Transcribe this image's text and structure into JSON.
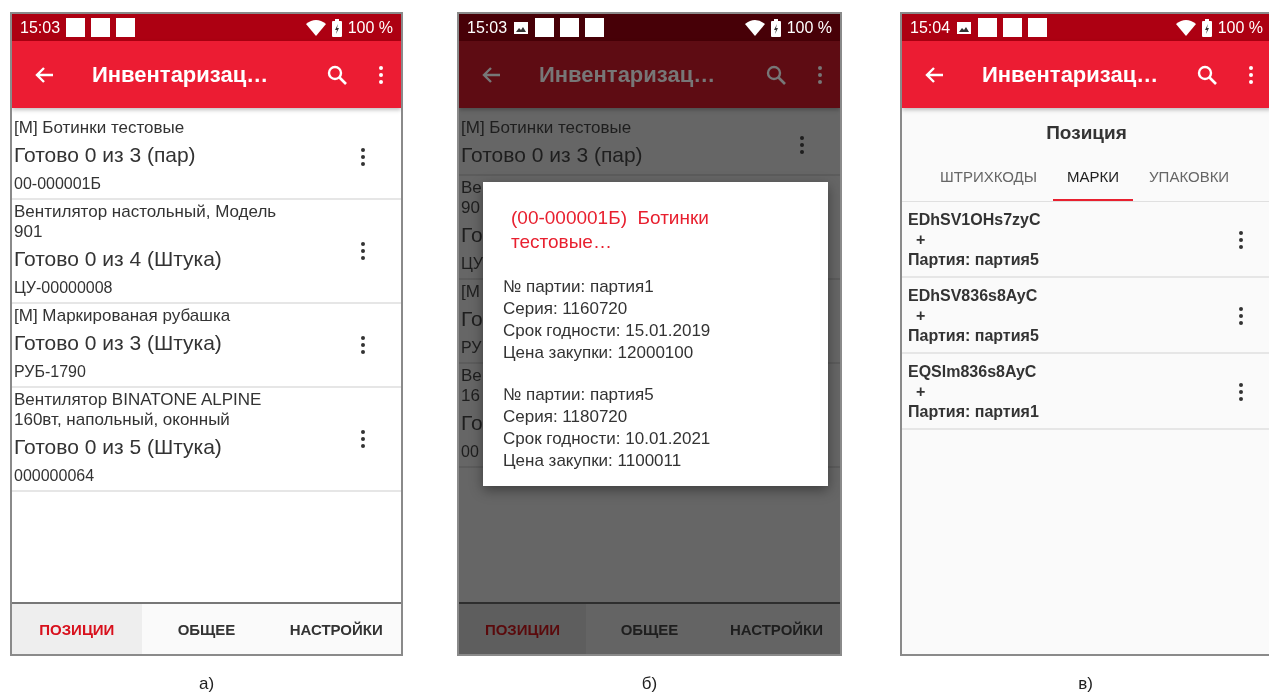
{
  "screens": [
    {
      "kind": "positions",
      "caption": "а)",
      "dimmed": false,
      "status_bar": {
        "time": "15:03",
        "notifications": [
          {
            "kind": "square"
          },
          {
            "kind": "square"
          },
          {
            "kind": "square"
          }
        ],
        "battery": "100 %"
      },
      "app_bar": {
        "title": "Инвентаризац…"
      },
      "items": [
        {
          "menu": true,
          "lines": [
            {
              "kind": "name",
              "text": "[М] Ботинки тестовые"
            },
            {
              "kind": "count",
              "text": "Готово 0 из 3 (пар)"
            },
            {
              "kind": "code",
              "text": "00-000001Б"
            }
          ]
        },
        {
          "menu": true,
          "lines": [
            {
              "kind": "name",
              "text": "Вентилятор настольный, Модель 901"
            },
            {
              "kind": "count",
              "text": "Готово 0 из 4 (Штука)"
            },
            {
              "kind": "code",
              "text": "ЦУ-00000008"
            }
          ]
        },
        {
          "menu": true,
          "lines": [
            {
              "kind": "name",
              "text": "[М] Маркированая рубашка"
            },
            {
              "kind": "count",
              "text": "Готово 0 из 3 (Штука)"
            },
            {
              "kind": "code",
              "text": "РУБ-1790"
            }
          ]
        },
        {
          "menu": true,
          "lines": [
            {
              "kind": "name",
              "text": "Вентилятор BINATONE ALPINE 160вт, напольный, оконный"
            },
            {
              "kind": "count",
              "text": "Готово 0 из 5 (Штука)"
            },
            {
              "kind": "code",
              "text": "000000064"
            }
          ]
        }
      ],
      "bottom_tabs": [
        {
          "label": "ПОЗИЦИИ",
          "selected": true
        },
        {
          "label": "ОБЩЕЕ",
          "selected": false
        },
        {
          "label": "НАСТРОЙКИ",
          "selected": false
        }
      ]
    },
    {
      "kind": "positions",
      "caption": "б)",
      "dimmed": true,
      "status_bar": {
        "time": "15:03",
        "notifications": [
          {
            "kind": "image"
          },
          {
            "kind": "square"
          },
          {
            "kind": "square"
          },
          {
            "kind": "square"
          }
        ],
        "battery": "100 %"
      },
      "app_bar": {
        "title": "Инвентаризац…"
      },
      "items": [
        {
          "menu": true,
          "lines": [
            {
              "kind": "name",
              "text": "[М] Ботинки тестовые"
            },
            {
              "kind": "count",
              "text": "Готово 0 из 3 (пар)"
            }
          ]
        },
        {
          "menu": false,
          "lines": [
            {
              "kind": "name",
              "text": "Ве"
            },
            {
              "kind": "name",
              "text": "90"
            },
            {
              "kind": "count",
              "text": "Го"
            },
            {
              "kind": "code",
              "text": "ЦУ"
            }
          ]
        },
        {
          "menu": false,
          "lines": [
            {
              "kind": "name",
              "text": "[М"
            },
            {
              "kind": "count",
              "text": "Го"
            },
            {
              "kind": "code",
              "text": "РУ"
            }
          ]
        },
        {
          "menu": false,
          "lines": [
            {
              "kind": "name",
              "text": "Ве"
            },
            {
              "kind": "name",
              "text": "16"
            },
            {
              "kind": "count",
              "text": "Го"
            },
            {
              "kind": "code",
              "text": "00"
            }
          ]
        }
      ],
      "dialog": {
        "title": "(00-000001Б)  Ботинки тестовые…",
        "paragraphs": [
          [
            "№ партии: партия1",
            "Серия: 1160720",
            "Срок годности: 15.01.2019",
            "Цена закупки: 12000100"
          ],
          [
            "№ партии: партия5",
            "Серия: 1180720",
            "Срок годности: 10.01.2021",
            "Цена закупки: 1100011"
          ]
        ]
      },
      "bottom_tabs": [
        {
          "label": "ПОЗИЦИИ",
          "selected": true
        },
        {
          "label": "ОБЩЕЕ",
          "selected": false
        },
        {
          "label": "НАСТРОЙКИ",
          "selected": false
        }
      ]
    },
    {
      "kind": "detail",
      "caption": "в)",
      "dimmed": false,
      "status_bar": {
        "time": "15:04",
        "notifications": [
          {
            "kind": "image"
          },
          {
            "kind": "square"
          },
          {
            "kind": "square"
          },
          {
            "kind": "square"
          }
        ],
        "battery": "100 %"
      },
      "app_bar": {
        "title": "Инвентаризац…"
      },
      "heading": "Позиция",
      "tabs": [
        {
          "label": "ШТРИХКОДЫ",
          "selected": false
        },
        {
          "label": "МАРКИ",
          "selected": true
        },
        {
          "label": "УПАКОВКИ",
          "selected": false
        }
      ],
      "marks": [
        {
          "code": "EDhSV1OHs7zyC",
          "plus": "+",
          "batch": "Партия: партия5"
        },
        {
          "code": "EDhSV836s8AyC",
          "plus": "+",
          "batch": "Партия: партия5"
        },
        {
          "code": "EQSlm836s8AyC",
          "plus": "+",
          "batch": "Партия: партия1"
        }
      ]
    }
  ]
}
